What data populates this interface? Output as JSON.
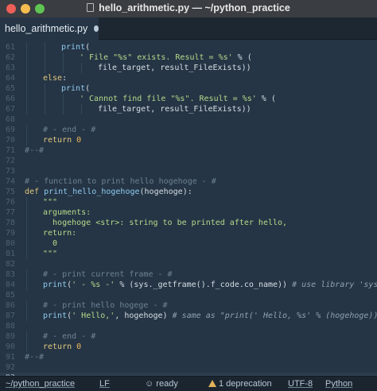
{
  "window": {
    "title": "hello_arithmetic.py — ~/python_practice"
  },
  "tab": {
    "label": "hello_arithmetic.py"
  },
  "editor": {
    "current_line": 93,
    "lines": [
      {
        "n": "61",
        "indent": 2,
        "segs": [
          [
            "f",
            "print"
          ],
          [
            "",
            "("
          ]
        ]
      },
      {
        "n": "62",
        "indent": 3,
        "segs": [
          [
            "s",
            "' File \"%s\" exists. Result = %s'"
          ],
          [
            "",
            " % ("
          ]
        ]
      },
      {
        "n": "63",
        "indent": 4,
        "segs": [
          [
            "",
            "file_target, result_FileExists))"
          ]
        ]
      },
      {
        "n": "64",
        "indent": 1,
        "segs": [
          [
            "k",
            "else"
          ],
          [
            "",
            ":"
          ]
        ]
      },
      {
        "n": "65",
        "indent": 2,
        "segs": [
          [
            "f",
            "print"
          ],
          [
            "",
            "("
          ]
        ]
      },
      {
        "n": "66",
        "indent": 3,
        "segs": [
          [
            "s",
            "' Cannot find file \"%s\". Result = %s'"
          ],
          [
            "",
            " % ("
          ]
        ]
      },
      {
        "n": "67",
        "indent": 4,
        "segs": [
          [
            "",
            "file_target, result_FileExists))"
          ]
        ]
      },
      {
        "n": "68",
        "indent": 0,
        "segs": []
      },
      {
        "n": "69",
        "indent": 1,
        "segs": [
          [
            "c",
            "# - end - #"
          ]
        ]
      },
      {
        "n": "70",
        "indent": 1,
        "segs": [
          [
            "k",
            "return"
          ],
          [
            "",
            " "
          ],
          [
            "n",
            "0"
          ]
        ]
      },
      {
        "n": "71",
        "indent": 0,
        "segs": [
          [
            "c",
            "#--#"
          ]
        ]
      },
      {
        "n": "72",
        "indent": 0,
        "segs": []
      },
      {
        "n": "73",
        "indent": 0,
        "segs": []
      },
      {
        "n": "74",
        "indent": 0,
        "segs": [
          [
            "c",
            "# - function to print hello hogehoge - #"
          ]
        ]
      },
      {
        "n": "75",
        "indent": 0,
        "segs": [
          [
            "k",
            "def"
          ],
          [
            "",
            " "
          ],
          [
            "f",
            "print_hello_hogehoge"
          ],
          [
            "",
            "(hogehoge):"
          ]
        ]
      },
      {
        "n": "76",
        "indent": 1,
        "segs": [
          [
            "s",
            "\"\"\""
          ]
        ]
      },
      {
        "n": "77",
        "indent": 1,
        "segs": [
          [
            "s",
            "arguments:"
          ]
        ]
      },
      {
        "n": "78",
        "indent": 1,
        "segs": [
          [
            "s",
            "  hogehoge <str>: string to be printed after hello,"
          ]
        ]
      },
      {
        "n": "79",
        "indent": 1,
        "segs": [
          [
            "s",
            "return:"
          ]
        ]
      },
      {
        "n": "80",
        "indent": 1,
        "segs": [
          [
            "s",
            "  0"
          ]
        ]
      },
      {
        "n": "81",
        "indent": 1,
        "segs": [
          [
            "s",
            "\"\"\""
          ]
        ]
      },
      {
        "n": "82",
        "indent": 0,
        "segs": []
      },
      {
        "n": "83",
        "indent": 1,
        "segs": [
          [
            "c",
            "# - print current frame - #"
          ]
        ]
      },
      {
        "n": "84",
        "indent": 1,
        "segs": [
          [
            "f",
            "print"
          ],
          [
            "",
            "("
          ],
          [
            "s",
            "' - %s -'"
          ],
          [
            "",
            " % (sys._getframe().f_code.co_name)) "
          ],
          [
            "ci",
            "# use library 'sys'"
          ]
        ]
      },
      {
        "n": "85",
        "indent": 0,
        "segs": []
      },
      {
        "n": "86",
        "indent": 1,
        "segs": [
          [
            "c",
            "# - print hello hogege - #"
          ]
        ]
      },
      {
        "n": "87",
        "indent": 1,
        "segs": [
          [
            "f",
            "print"
          ],
          [
            "",
            "("
          ],
          [
            "s",
            "' Hello,'"
          ],
          [
            "",
            ", hogehoge) "
          ],
          [
            "ci",
            "# same as \"print(' Hello, %s' % (hogehoge))\""
          ]
        ]
      },
      {
        "n": "88",
        "indent": 0,
        "segs": []
      },
      {
        "n": "89",
        "indent": 1,
        "segs": [
          [
            "c",
            "# - end - #"
          ]
        ]
      },
      {
        "n": "90",
        "indent": 1,
        "segs": [
          [
            "k",
            "return"
          ],
          [
            "",
            " "
          ],
          [
            "n",
            "0"
          ]
        ]
      },
      {
        "n": "91",
        "indent": 0,
        "segs": [
          [
            "c",
            "#--#"
          ]
        ]
      },
      {
        "n": "92",
        "indent": 0,
        "segs": []
      },
      {
        "n": "93",
        "indent": 0,
        "segs": []
      }
    ]
  },
  "statusbar": {
    "path": "~/python_practice",
    "line_ending": "LF",
    "status_label": "ready",
    "deprecation": "1 deprecation",
    "encoding": "UTF-8",
    "grammar": "Python"
  },
  "colors": {
    "keyword": "#e0c67e",
    "string": "#b6d98a",
    "comment": "#6d8294",
    "function": "#8fc9ee",
    "number": "#f0b95b",
    "background": "#253545"
  }
}
